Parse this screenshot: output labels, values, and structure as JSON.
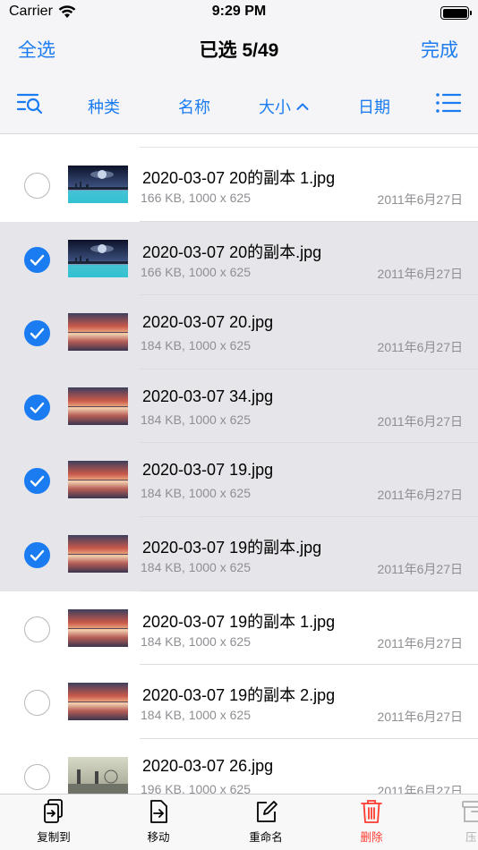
{
  "status_bar": {
    "carrier": "Carrier",
    "time": "9:29 PM"
  },
  "nav": {
    "select_all": "全选",
    "title": "已选 5/49",
    "done": "完成"
  },
  "sort_bar": {
    "kind": "种类",
    "name": "名称",
    "size": "大小",
    "size_sort_glyph": "^",
    "date": "日期"
  },
  "files": [
    {
      "name": "2020-03-07  20的副本 1.jpg",
      "meta": "166 KB, 1000 x 625",
      "date": "2011年6月27日",
      "selected": false,
      "thumb": "planet"
    },
    {
      "name": "2020-03-07  20的副本.jpg",
      "meta": "166 KB, 1000 x 625",
      "date": "2011年6月27日",
      "selected": true,
      "thumb": "planet"
    },
    {
      "name": "2020-03-07  20.jpg",
      "meta": "184 KB, 1000 x 625",
      "date": "2011年6月27日",
      "selected": true,
      "thumb": "sunset"
    },
    {
      "name": "2020-03-07  34.jpg",
      "meta": "184 KB, 1000 x 625",
      "date": "2011年6月27日",
      "selected": true,
      "thumb": "sunset"
    },
    {
      "name": "2020-03-07  19.jpg",
      "meta": "184 KB, 1000 x 625",
      "date": "2011年6月27日",
      "selected": true,
      "thumb": "sunset"
    },
    {
      "name": "2020-03-07  19的副本.jpg",
      "meta": "184 KB, 1000 x 625",
      "date": "2011年6月27日",
      "selected": true,
      "thumb": "sunset"
    },
    {
      "name": "2020-03-07  19的副本 1.jpg",
      "meta": "184 KB, 1000 x 625",
      "date": "2011年6月27日",
      "selected": false,
      "thumb": "sunset"
    },
    {
      "name": "2020-03-07  19的副本 2.jpg",
      "meta": "184 KB, 1000 x 625",
      "date": "2011年6月27日",
      "selected": false,
      "thumb": "sunset"
    },
    {
      "name": "2020-03-07  26.jpg",
      "meta": "196 KB, 1000 x 625",
      "date": "2011年6月27日",
      "selected": false,
      "thumb": "city"
    }
  ],
  "toolbar": {
    "copy_to": "复制到",
    "move": "移动",
    "rename": "重命名",
    "delete": "删除",
    "compress": "压"
  },
  "colors": {
    "accent": "#1a7cf0",
    "danger": "#ff3b30",
    "selected_row": "#e5e5ea"
  }
}
